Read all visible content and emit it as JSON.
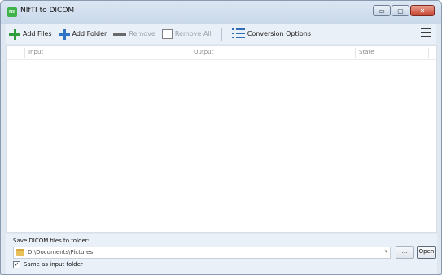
{
  "window": {
    "title": "NIfTI to DICOM",
    "app_icon_text": "NII",
    "controls": {
      "minimize": "▭",
      "maximize": "▢",
      "close": "✕"
    }
  },
  "toolbar": {
    "add_files": "Add Files",
    "add_folder": "Add Folder",
    "remove": "Remove",
    "remove_all": "Remove All",
    "conversion_options": "Conversion Options",
    "add_icon_color": "#2e9e3a",
    "add_folder_icon_color": "#2f74c5"
  },
  "list": {
    "columns": [
      "Input",
      "Output",
      "State"
    ],
    "rows": []
  },
  "output": {
    "label": "Save DICOM files to folder:",
    "path": "D:\\Documents\\Pictures",
    "combo_arrow": "▾",
    "browse_label": "...",
    "open_label": "Open",
    "same_as_input_checked": true,
    "same_as_input_label": "Same as input folder",
    "check_mark": "✓"
  }
}
